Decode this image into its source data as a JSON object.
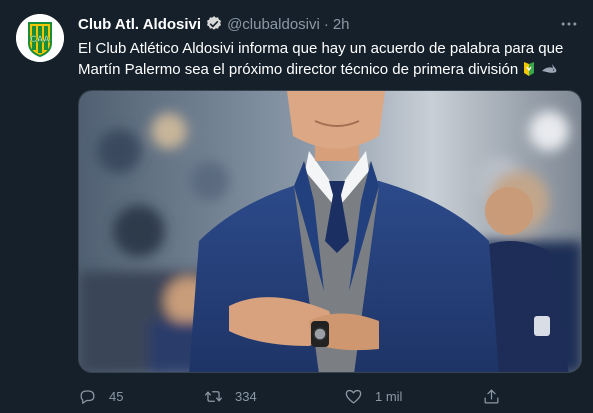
{
  "tweet": {
    "display_name": "Club Atl. Aldosivi",
    "handle": "@clubaldosivi",
    "separator": "·",
    "time_ago": "2h",
    "text_line_1": "El Club Atlético Aldosivi informa que hay un acuerdo de palabra para que",
    "text_line_2": "Martín Palermo sea el próximo director técnico de primera división",
    "emojis": [
      "yellow-green-badge-emoji",
      "shark-emoji"
    ]
  },
  "avatar": {
    "logo_text": "CAA",
    "colors": {
      "green": "#1a8f3a",
      "yellow": "#f2c500"
    }
  },
  "actions": {
    "reply_count": "45",
    "retweet_count": "334",
    "like_count": "1 mil"
  },
  "icons": [
    "verified-badge-icon",
    "more-icon",
    "reply-icon",
    "retweet-icon",
    "like-icon",
    "share-icon"
  ],
  "colors": {
    "background": "#15202b",
    "text": "#ffffff",
    "muted": "#8b98a5",
    "verified": "#d9d9d9",
    "border": "#38444d"
  }
}
